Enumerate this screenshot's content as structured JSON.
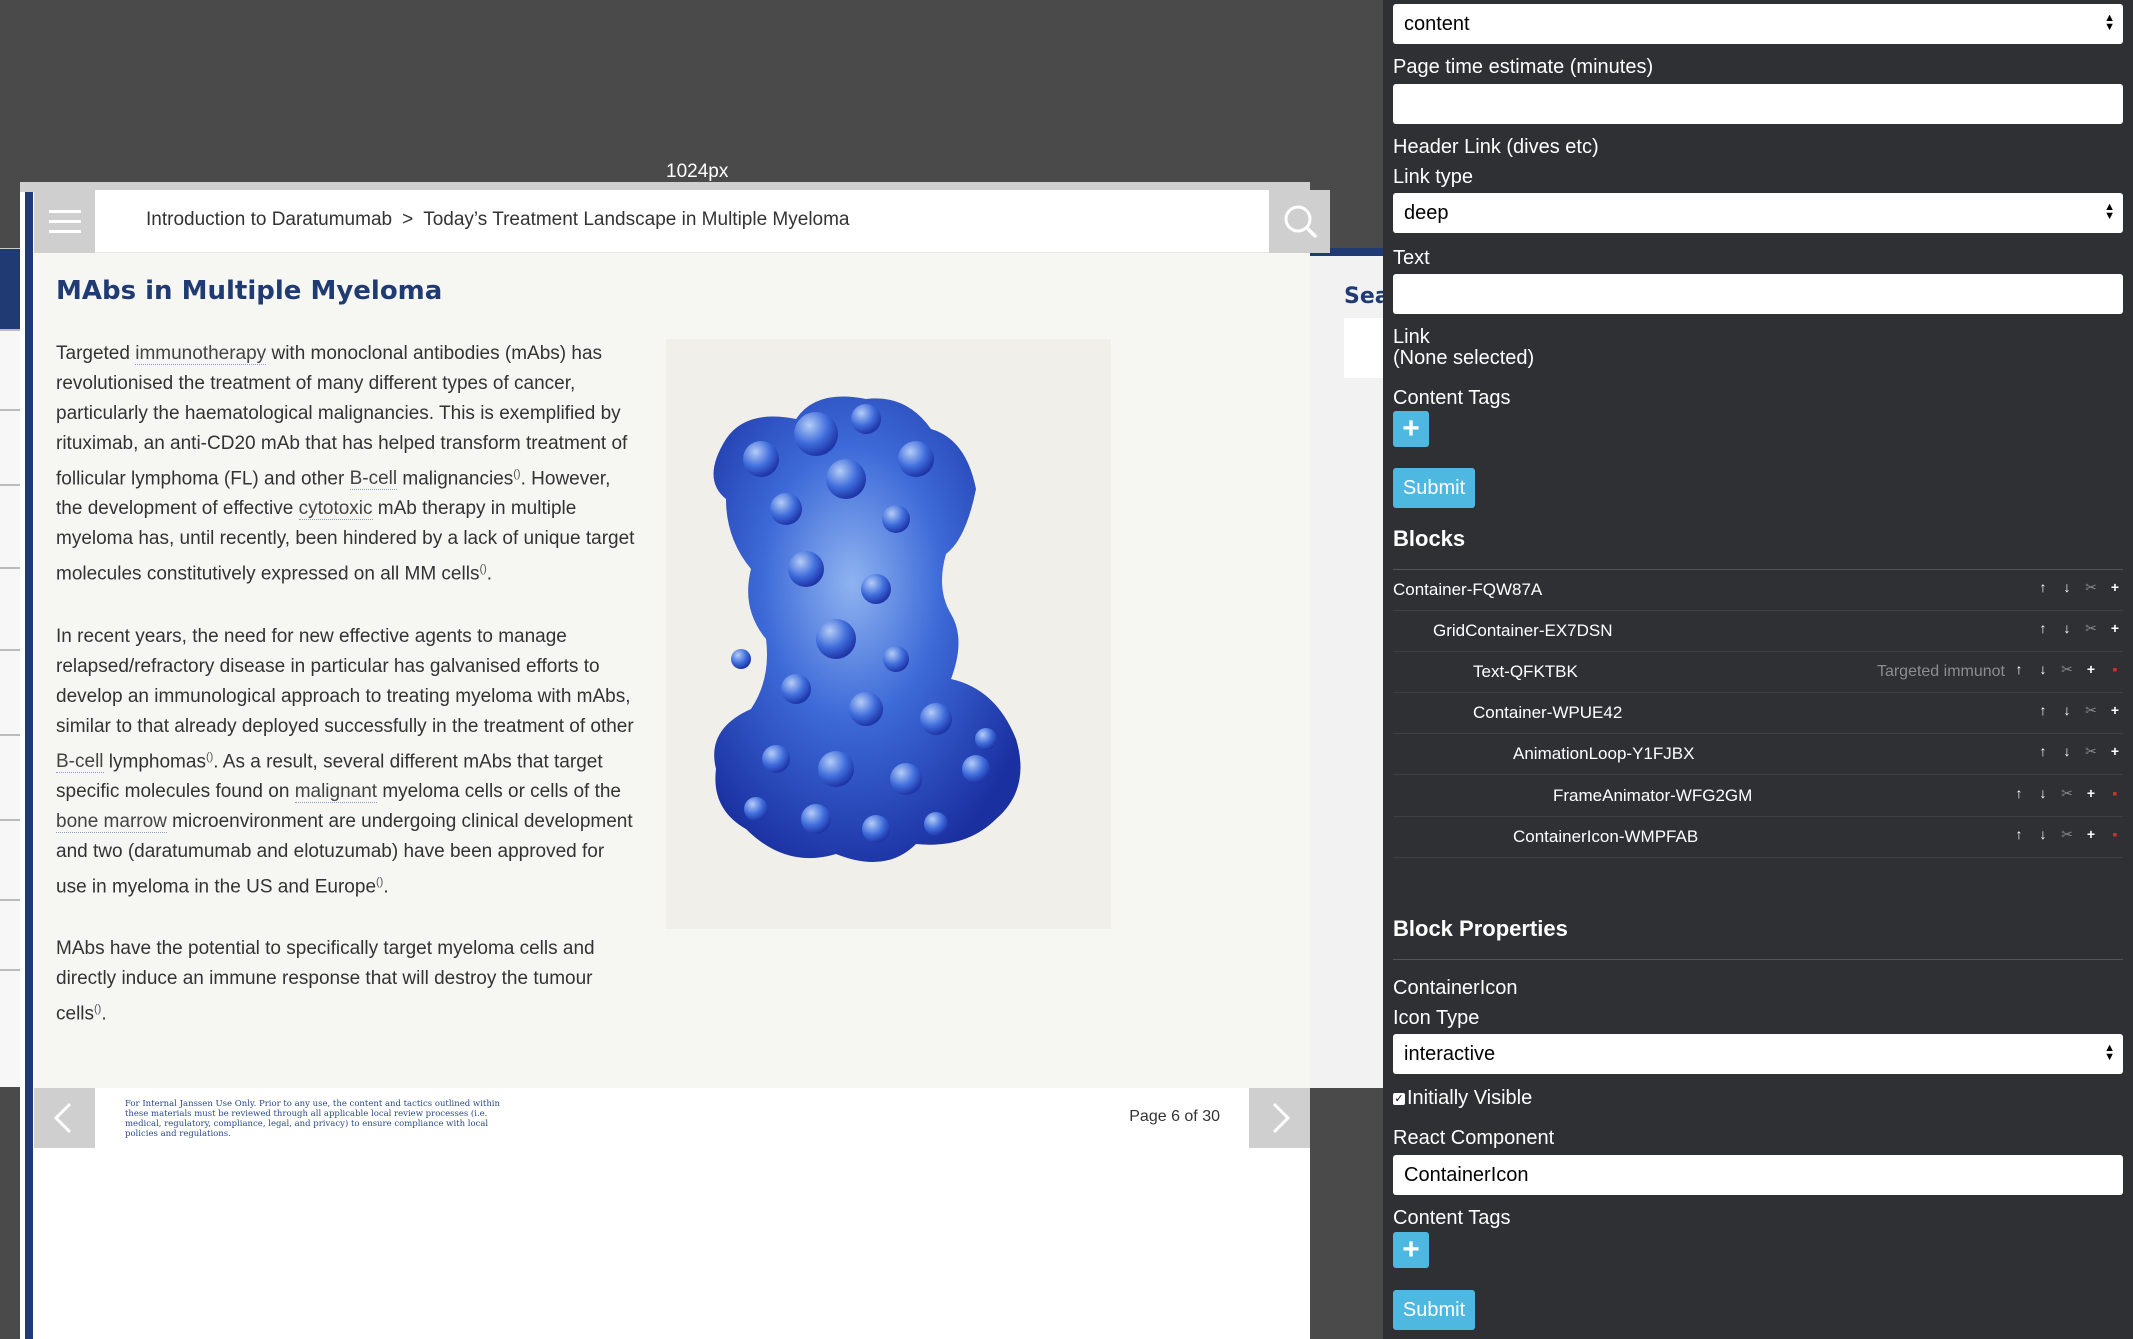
{
  "viewport_label": "1024px",
  "reader": {
    "breadcrumb": {
      "first": "Introduction to Daratumumab",
      "separator": ">",
      "second": "Today’s Treatment Landscape in Multiple Myeloma"
    },
    "title": "MAbs in Multiple Myeloma",
    "p1": {
      "a": "Targeted ",
      "link1": "immunotherapy",
      "b": " with monoclonal antibodies (mAbs) has revolutionised the treatment of many different types of cancer, particularly the haematological malignancies. This is exemplified by rituximab, an anti-CD20 mAb that has helped transform treatment of follicular lymphoma (FL) and other ",
      "link2": "B-cell",
      "c": " malignancies",
      "ref1": "()",
      "d": ". However, the development of effective ",
      "link3": "cytotoxic",
      "e": " mAb therapy in multiple myeloma has, until recently, been hindered by a lack of unique target molecules constitutively expressed on all MM cells",
      "ref2": "()",
      "f": "."
    },
    "p2": {
      "a": "In recent years, the need for new effective agents to manage relapsed/refractory disease in particular has galvanised efforts to develop an immunological approach to treating myeloma with mAbs, similar to that already deployed successfully in the treatment of other ",
      "link1": "B-cell",
      "b": " lymphomas",
      "ref1": "()",
      "c": ". As a result, several different mAbs that target specific molecules found on ",
      "link2": "malignant",
      "d": " myeloma cells or cells of the ",
      "link3": "bone marrow",
      "e": " microenvironment are undergoing clinical development and two (daratumumab and elotuzumab) have been approved for use in myeloma in the US and Europe",
      "ref2": "()",
      "f": "."
    },
    "p3": {
      "a": "MAbs have the potential to specifically target myeloma cells and directly induce an immune response that will destroy the tumour cells",
      "ref1": "()",
      "b": "."
    },
    "disclaimer": "For Internal Janssen Use Only. Prior to any use, the content and tactics outlined within these materials must be reviewed through all applicable local review processes (i.e. medical, regulatory, compliance, legal, and privacy) to ensure compliance with local policies and regulations.",
    "page_indicator": "Page 6 of 30",
    "background_panel_text": "Sear",
    "icons": {
      "menu": "hamburger-menu-icon",
      "search": "search-icon",
      "prev": "chevron-left-icon",
      "next": "chevron-right-icon"
    }
  },
  "editor": {
    "page_type_value": "content",
    "time_label": "Page time estimate (minutes)",
    "time_value": "",
    "header_link_label": "Header Link (dives etc)",
    "link_type_label": "Link type",
    "link_type_value": "deep",
    "text_label": "Text",
    "text_value": "",
    "link_label": "Link",
    "link_value": "(None selected)",
    "content_tags_label": "Content Tags",
    "plus": "+",
    "submit": "Submit",
    "blocks_heading": "Blocks",
    "blocks": [
      {
        "name": "Container-FQW87A",
        "preview": ""
      },
      {
        "name": "GridContainer-EX7DSN",
        "preview": ""
      },
      {
        "name": "Text-QFKTBK",
        "preview": "Targeted immunot"
      },
      {
        "name": "Container-WPUE42",
        "preview": ""
      },
      {
        "name": "AnimationLoop-Y1FJBX",
        "preview": ""
      },
      {
        "name": "FrameAnimator-WFG2GM",
        "preview": ""
      },
      {
        "name": "ContainerIcon-WMPFAB",
        "preview": ""
      }
    ],
    "controls": {
      "up": "↑",
      "down": "↓",
      "cut": "✂",
      "add": "+",
      "delete": "▪"
    },
    "block_props_heading": "Block Properties",
    "block_type": "ContainerIcon",
    "icon_type_label": "Icon Type",
    "icon_type_value": "interactive",
    "initially_visible_label": "Initially Visible",
    "initially_visible_checked": true,
    "react_component_label": "React Component",
    "react_component_value": "ContainerIcon",
    "content_tags_label_2": "Content Tags",
    "submit_2": "Submit"
  }
}
